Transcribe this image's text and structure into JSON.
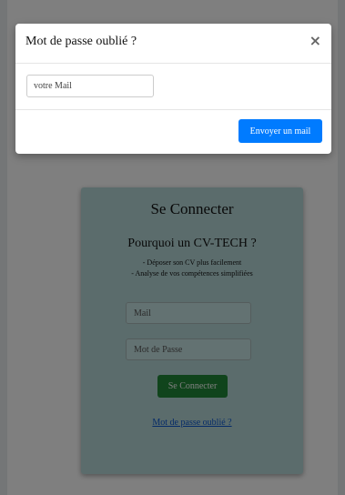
{
  "login": {
    "title": "Se Connecter",
    "subtitle": "Pourquoi un CV-TECH ?",
    "bullets": [
      "- Déposer son CV plus facilement",
      "- Analyse de vos compétences simplifiées"
    ],
    "mail_placeholder": "Mail",
    "password_placeholder": "Mot de Passe",
    "submit_label": "Se Connecter",
    "forgot_link": "Mot de passe oublié ?"
  },
  "modal": {
    "title": "Mot de passe oublié ?",
    "close_symbol": "×",
    "email_placeholder": "votre Mail",
    "send_label": "Envoyer un mail"
  },
  "colors": {
    "card_background": "#b7d9d9",
    "primary_button": "#007bff",
    "success_button": "#218838",
    "link": "#0b57d0"
  }
}
